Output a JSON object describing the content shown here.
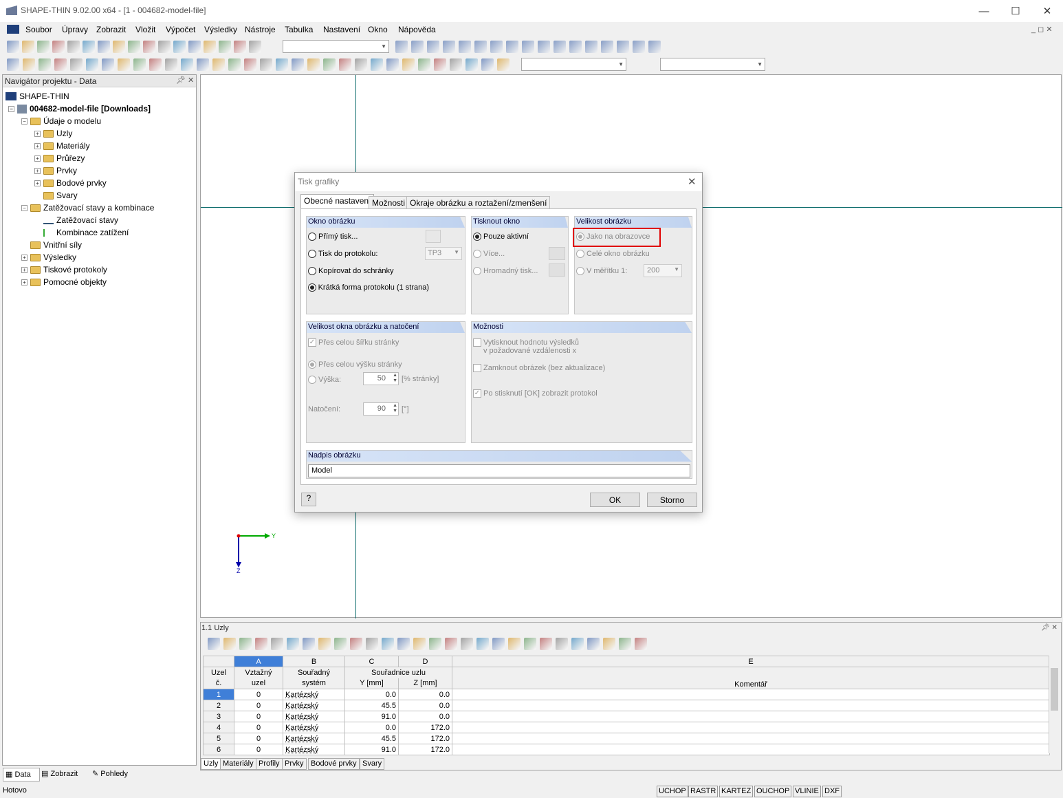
{
  "window": {
    "title": "SHAPE-THIN 9.02.00 x64 - [1 - 004682-model-file]"
  },
  "menu": [
    "Soubor",
    "Úpravy",
    "Zobrazit",
    "Vložit",
    "Výpočet",
    "Výsledky",
    "Nástroje",
    "Tabulka",
    "Nastavení",
    "Okno",
    "Nápověda"
  ],
  "navigator": {
    "title": "Navigátor projektu - Data",
    "root": "SHAPE-THIN",
    "file": "004682-model-file [Downloads]",
    "items": [
      "Údaje o modelu",
      "Uzly",
      "Materiály",
      "Průřezy",
      "Prvky",
      "Bodové prvky",
      "Svary",
      "Zatěžovací stavy a kombinace",
      "Zatěžovací stavy",
      "Kombinace zatížení",
      "Vnitřní síly",
      "Výsledky",
      "Tiskové protokoly",
      "Pomocné objekty"
    ],
    "tabs": [
      "Data",
      "Zobrazit",
      "Pohledy"
    ]
  },
  "axes": {
    "y": "Y",
    "z": "Z"
  },
  "dialog": {
    "title": "Tisk grafiky",
    "tabs": [
      "Obecné nastavení",
      "Možnosti",
      "Okraje obrázku a roztažení/zmenšení"
    ],
    "g1": {
      "title": "Okno obrázku",
      "o1": "Přímý tisk...",
      "o2": "Tisk do protokolu:",
      "combo": "TP3",
      "o3": "Kopírovat do schránky",
      "o4": "Krátká forma protokolu (1 strana)"
    },
    "g2": {
      "title": "Tisknout okno",
      "o1": "Pouze aktivní",
      "o2": "Více...",
      "o3": "Hromadný tisk..."
    },
    "g3": {
      "title": "Velikost obrázku",
      "o1": "Jako na obrazovce",
      "o2": "Celé okno obrázku",
      "o3": "V měřítku 1:",
      "scale": "200"
    },
    "g4": {
      "title": "Velikost okna obrázku a natočení",
      "o1": "Přes celou šířku stránky",
      "o2": "Přes celou výšku stránky",
      "o3": "Výška:",
      "height": "50",
      "height_unit": "[% stránky]",
      "rot_label": "Natočení:",
      "rot": "90",
      "rot_unit": "[°]"
    },
    "g5": {
      "title": "Možnosti",
      "o1a": "Vytisknout hodnotu výsledků",
      "o1b": "v požadované vzdálenosti x",
      "o2": "Zamknout obrázek (bez aktualizace)",
      "o3": "Po stisknutí [OK] zobrazit protokol"
    },
    "g6": {
      "title": "Nadpis obrázku",
      "value": "Model"
    },
    "ok": "OK",
    "cancel": "Storno"
  },
  "table": {
    "title": "1.1 Uzly",
    "cols": [
      "A",
      "B",
      "C",
      "D",
      "E"
    ],
    "h1": [
      "Uzel",
      "Vztažný",
      "Souřadný",
      "Souřadnice uzlu",
      "Komentář"
    ],
    "h2": [
      "č.",
      "uzel",
      "systém",
      "Y [mm]",
      "Z [mm]"
    ],
    "rows": [
      [
        "1",
        "0",
        "Kartézský",
        "0.0",
        "0.0"
      ],
      [
        "2",
        "0",
        "Kartézský",
        "45.5",
        "0.0"
      ],
      [
        "3",
        "0",
        "Kartézský",
        "91.0",
        "0.0"
      ],
      [
        "4",
        "0",
        "Kartézský",
        "0.0",
        "172.0"
      ],
      [
        "5",
        "0",
        "Kartézský",
        "45.5",
        "172.0"
      ],
      [
        "6",
        "0",
        "Kartézský",
        "91.0",
        "172.0"
      ]
    ],
    "tabs": [
      "Uzly",
      "Materiály",
      "Profily",
      "Prvky",
      "Bodové prvky",
      "Svary"
    ]
  },
  "status": {
    "text": "Hotovo",
    "boxes": [
      "UCHOP",
      "RASTR",
      "KARTEZ",
      "OUCHOP",
      "VLINIE",
      "DXF"
    ]
  }
}
